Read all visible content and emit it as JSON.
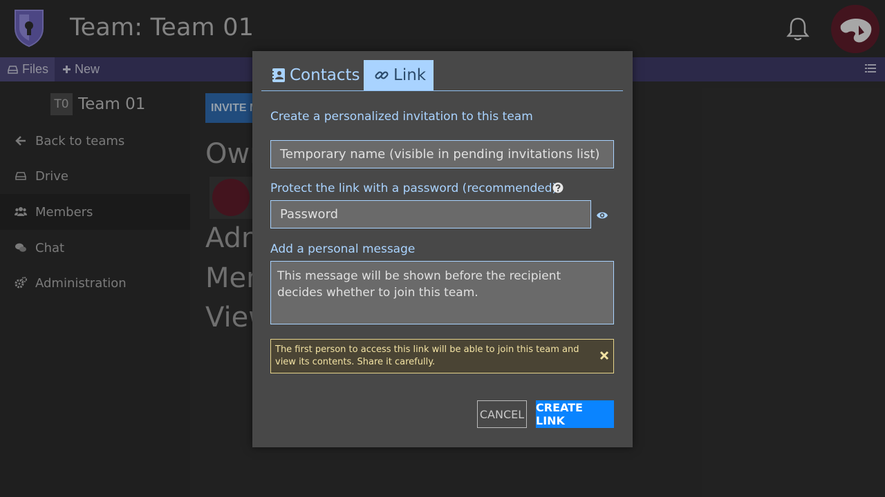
{
  "header": {
    "team_title": "Team: Team 01"
  },
  "toolbar": {
    "files_label": "Files",
    "new_label": "New"
  },
  "sidebar": {
    "team_badge": "T0",
    "team_name": "Team 01",
    "items": [
      {
        "label": "Back to teams",
        "icon": "arrow-left-icon"
      },
      {
        "label": "Drive",
        "icon": "drive-icon"
      },
      {
        "label": "Members",
        "icon": "users-icon"
      },
      {
        "label": "Chat",
        "icon": "chat-icon"
      },
      {
        "label": "Administration",
        "icon": "cogs-icon"
      }
    ]
  },
  "main": {
    "invite_button": "INVITE M",
    "roles": [
      "Owners",
      "Admins",
      "Members",
      "Viewers"
    ]
  },
  "modal": {
    "tabs": [
      {
        "label": "Contacts",
        "icon": "contact-card-icon"
      },
      {
        "label": "Link",
        "icon": "link-icon"
      }
    ],
    "intro": "Create a personalized invitation to this team",
    "name_placeholder": "Temporary name (visible in pending invitations list)",
    "password_label": "Protect the link with a password (recommended)",
    "password_placeholder": "Password",
    "message_label": "Add a personal message",
    "message_placeholder": "This message will be shown before the recipient decides whether to join this team.",
    "warning": "The first person to access this link will be able to join this team and view its contents. Share it carefully.",
    "cancel": "CANCEL",
    "create": "CREATE LINK"
  },
  "colors": {
    "accent": "#a9d3ff",
    "primary_button": "#0a84ff",
    "toolbar": "#3e3a66",
    "warning_border": "#e7d58b"
  }
}
